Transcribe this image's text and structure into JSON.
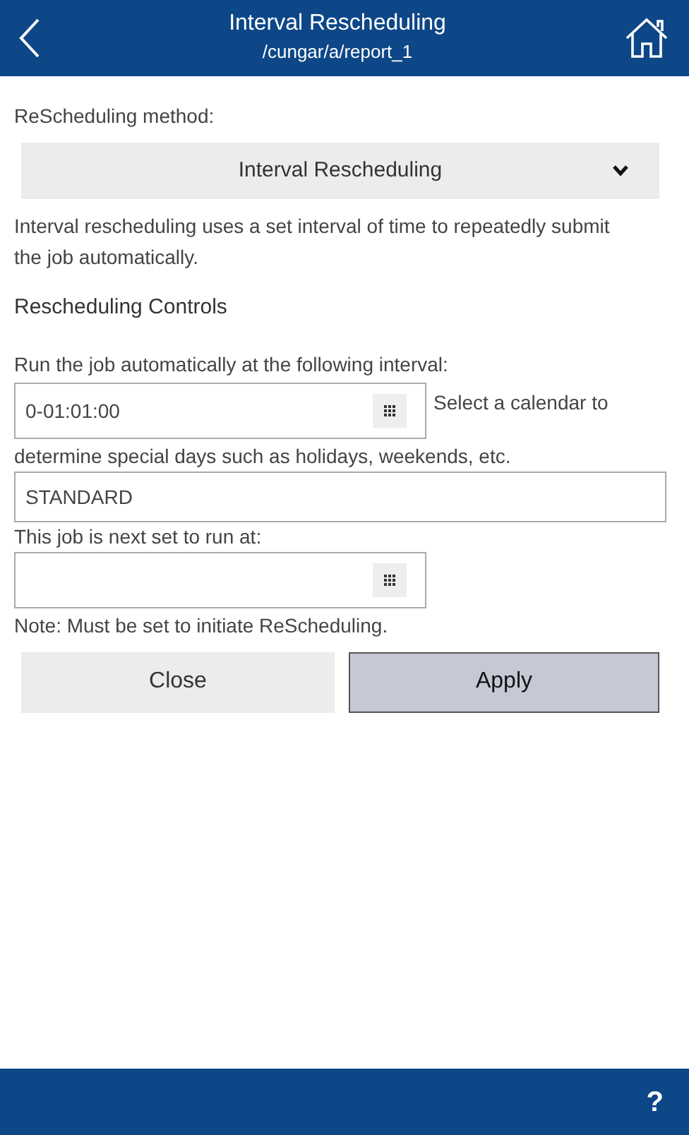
{
  "header": {
    "title": "Interval Rescheduling",
    "subtitle": "/cungar/a/report_1"
  },
  "method": {
    "label": "ReScheduling method:",
    "value": "Interval Rescheduling",
    "description": "Interval rescheduling uses a set interval of time to repeatedly submit the job automatically."
  },
  "controls": {
    "heading": "Rescheduling Controls",
    "interval_label": "Run the job automatically at the following interval:",
    "interval_value": "0-01:01:00",
    "calendar_label": [
      "Select a calendar to",
      "determine special days such as holidays, weekends, etc."
    ],
    "calendar_value": "STANDARD",
    "next_run_label": "This job is next set to run at:",
    "note": "Note: Must be set to initiate ReScheduling."
  },
  "buttons": [
    {
      "label": "Close",
      "kind": "secondary"
    },
    {
      "label": "Apply",
      "kind": "primary"
    }
  ],
  "footer": {
    "help": "?"
  }
}
